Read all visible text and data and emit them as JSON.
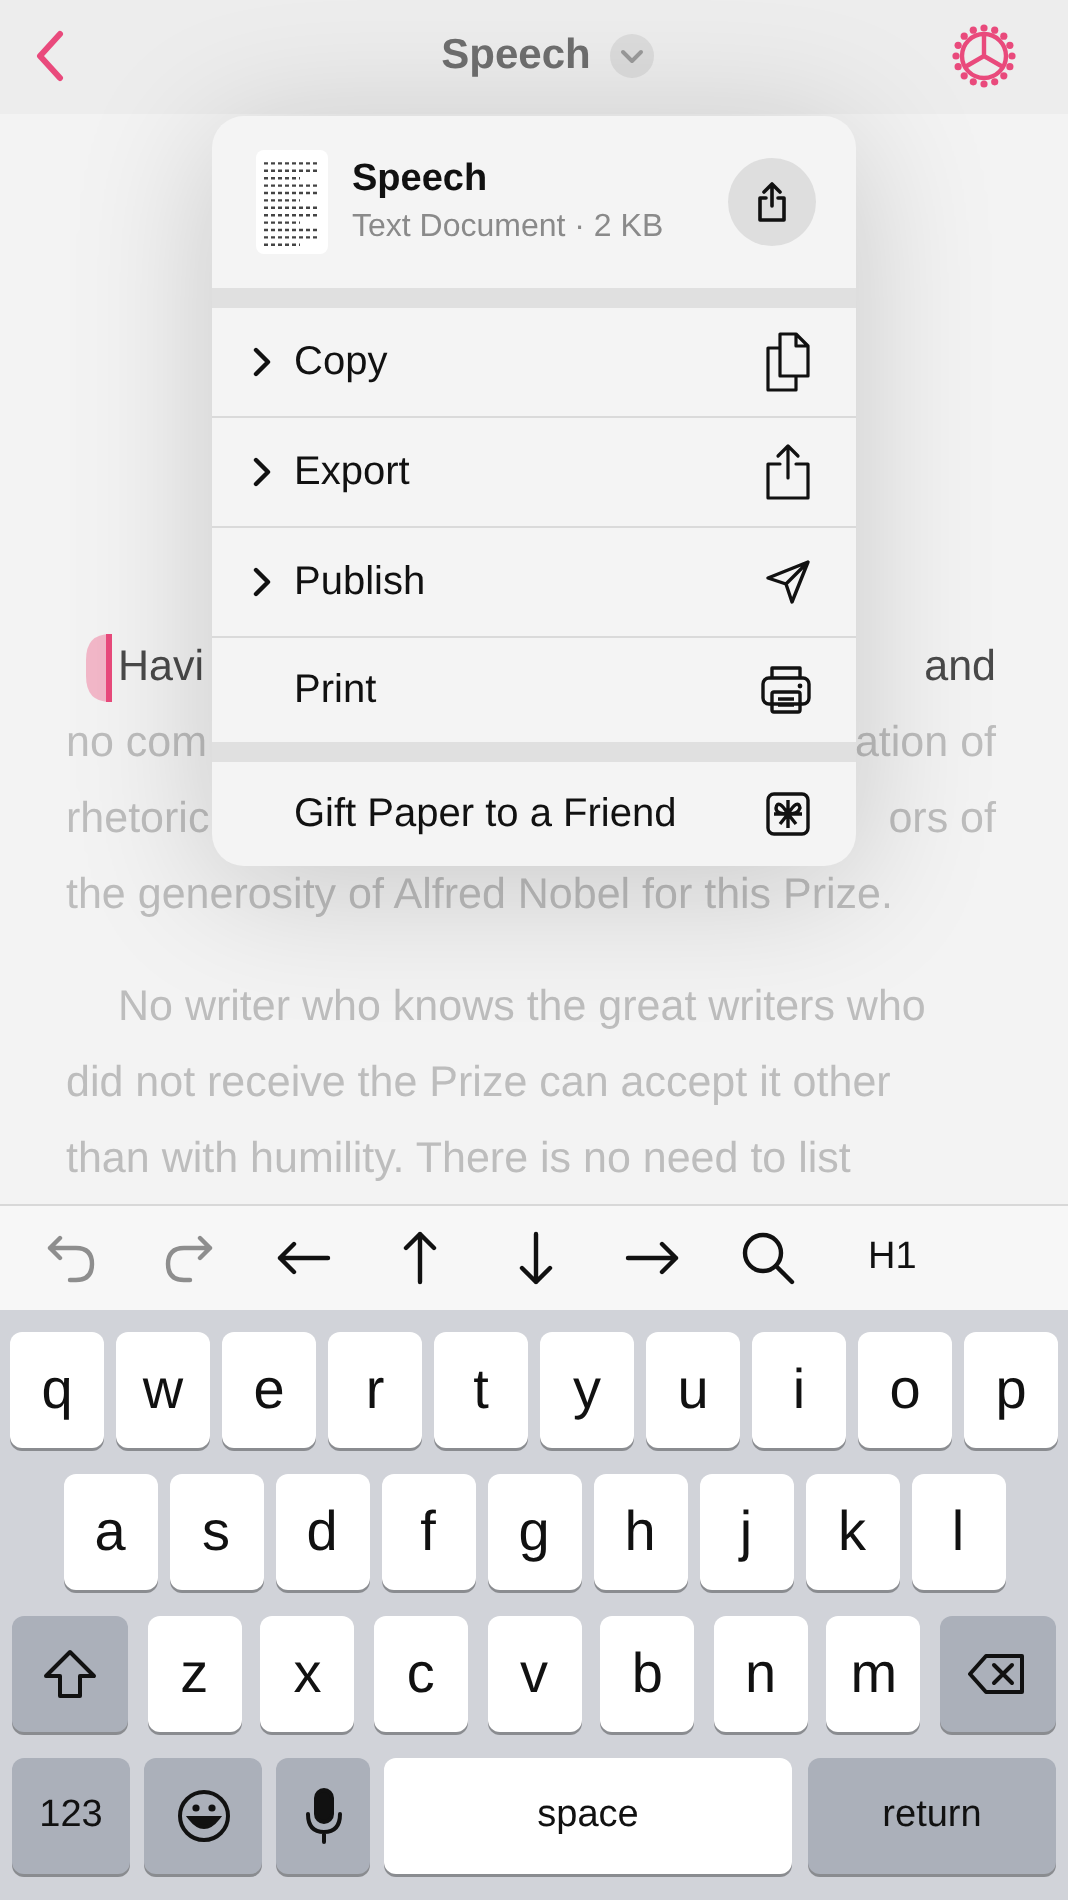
{
  "nav": {
    "title": "Speech"
  },
  "editor": {
    "paragraphs": [
      {
        "lines": [
          {
            "left": "Havi",
            "right": "and",
            "current": true
          },
          {
            "left": "no com",
            "right": "ation of",
            "current": false
          },
          {
            "left": "rhetoric",
            "right": "ors of",
            "current": false
          },
          {
            "left": "the generosity of Alfred Nobel for this Prize.",
            "current": false
          }
        ]
      },
      {
        "lines": [
          {
            "left": "No writer who knows the great writers who",
            "current": false
          },
          {
            "left": "did not receive the Prize can accept it other",
            "current": false
          },
          {
            "left": "than with humility. There is no need to list",
            "current": false
          }
        ]
      }
    ]
  },
  "menu": {
    "header": {
      "title": "Speech",
      "subtitle": "Text Document · 2 KB"
    },
    "sections": [
      [
        {
          "label": "Copy",
          "submenu": true,
          "kind": "copy"
        },
        {
          "label": "Export",
          "submenu": true,
          "kind": "export"
        },
        {
          "label": "Publish",
          "submenu": true,
          "kind": "publish"
        },
        {
          "label": "Print",
          "submenu": false,
          "kind": "print"
        }
      ],
      [
        {
          "label": "Gift Paper to a Friend",
          "submenu": false,
          "kind": "gift"
        }
      ]
    ]
  },
  "toolbar": [
    {
      "kind": "undo",
      "disabled": true
    },
    {
      "kind": "redo",
      "disabled": true
    },
    {
      "kind": "left",
      "disabled": false
    },
    {
      "kind": "up",
      "disabled": false
    },
    {
      "kind": "down",
      "disabled": false
    },
    {
      "kind": "right",
      "disabled": false
    },
    {
      "kind": "search",
      "disabled": false
    },
    {
      "kind": "text",
      "label": "H1",
      "disabled": false
    }
  ],
  "keyboard": [
    [
      {
        "kind": "letter",
        "label": "q"
      },
      {
        "kind": "letter",
        "label": "w"
      },
      {
        "kind": "letter",
        "label": "e"
      },
      {
        "kind": "letter",
        "label": "r"
      },
      {
        "kind": "letter",
        "label": "t"
      },
      {
        "kind": "letter",
        "label": "y"
      },
      {
        "kind": "letter",
        "label": "u"
      },
      {
        "kind": "letter",
        "label": "i"
      },
      {
        "kind": "letter",
        "label": "o"
      },
      {
        "kind": "letter",
        "label": "p"
      }
    ],
    [
      {
        "kind": "letter",
        "label": "a"
      },
      {
        "kind": "letter",
        "label": "s"
      },
      {
        "kind": "letter",
        "label": "d"
      },
      {
        "kind": "letter",
        "label": "f"
      },
      {
        "kind": "letter",
        "label": "g"
      },
      {
        "kind": "letter",
        "label": "h"
      },
      {
        "kind": "letter",
        "label": "j"
      },
      {
        "kind": "letter",
        "label": "k"
      },
      {
        "kind": "letter",
        "label": "l"
      }
    ],
    [
      {
        "kind": "shift"
      },
      {
        "kind": "letter",
        "label": "z"
      },
      {
        "kind": "letter",
        "label": "x"
      },
      {
        "kind": "letter",
        "label": "c"
      },
      {
        "kind": "letter",
        "label": "v"
      },
      {
        "kind": "letter",
        "label": "b"
      },
      {
        "kind": "letter",
        "label": "n"
      },
      {
        "kind": "letter",
        "label": "m"
      },
      {
        "kind": "delete"
      }
    ],
    [
      {
        "kind": "numbers",
        "label": "123"
      },
      {
        "kind": "emoji"
      },
      {
        "kind": "mic"
      },
      {
        "kind": "space",
        "label": "space"
      },
      {
        "kind": "return",
        "label": "return"
      }
    ]
  ]
}
